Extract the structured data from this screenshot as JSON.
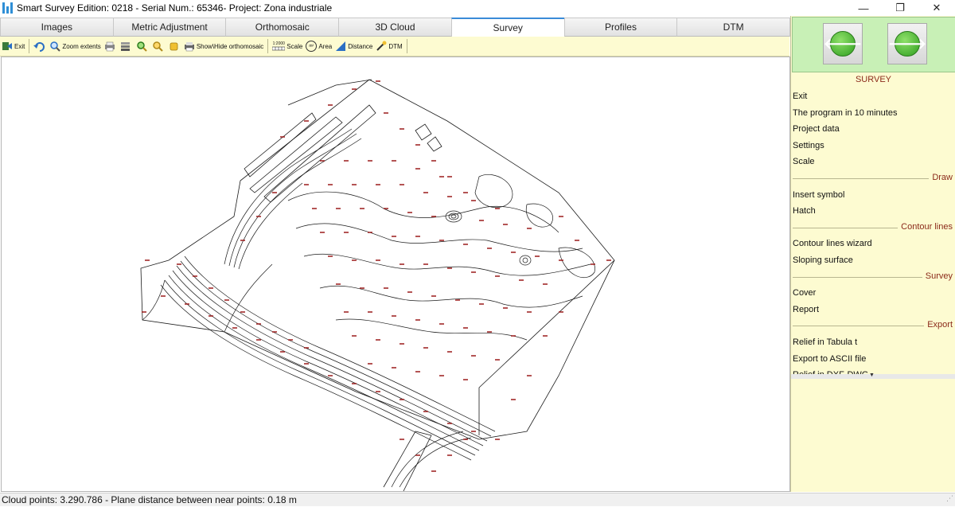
{
  "window": {
    "title": "Smart Survey  Edition: 0218 - Serial Num.: 65346- Project: Zona industriale",
    "minimize_glyph": "—",
    "restore_glyph": "❐",
    "close_glyph": "✕"
  },
  "tabs": [
    {
      "label": "Images"
    },
    {
      "label": "Metric Adjustment"
    },
    {
      "label": "Orthomosaic"
    },
    {
      "label": "3D Cloud"
    },
    {
      "label": "Survey",
      "active": true
    },
    {
      "label": "Profiles"
    },
    {
      "label": "DTM"
    }
  ],
  "toolbar": {
    "exit": "Exit",
    "zoom_extents": "Zoom extents",
    "show_hide_ortho": "Show\\Hide orthomosaic",
    "scale": "Scale",
    "area": "Area",
    "distance": "Distance",
    "dtm": "DTM",
    "scale_icon_text": "1:2000",
    "area_icon_text": "m²"
  },
  "sidebar": {
    "title": "SURVEY",
    "prev_glyph": "🡐",
    "next_glyph": "🡒",
    "items": [
      {
        "label": "Exit"
      },
      {
        "label": "The program in 10 minutes"
      },
      {
        "label": "Project data"
      },
      {
        "label": "Settings"
      },
      {
        "label": "Scale"
      }
    ],
    "sections": {
      "draw": "Draw",
      "contour": "Contour lines",
      "survey": "Survey",
      "export": "Export"
    },
    "draw_items": [
      {
        "label": "Insert symbol"
      },
      {
        "label": "Hatch"
      }
    ],
    "contour_items": [
      {
        "label": "Contour lines wizard"
      },
      {
        "label": "Sloping surface"
      }
    ],
    "survey_items": [
      {
        "label": "Cover"
      },
      {
        "label": "Report"
      }
    ],
    "export_items": [
      {
        "label": "Relief in Tabula t"
      },
      {
        "label": "Export to ASCII file"
      },
      {
        "label": "Relief in DXF-DWG"
      }
    ],
    "scroll_glyph": "▼"
  },
  "status": {
    "text": "Cloud points: 3.290.786 - Plane distance between near points: 0.18 m"
  },
  "colors": {
    "panel_bg": "#fdfbd1",
    "nav_bg": "#c8f0b6",
    "contour": "#1a1a1a",
    "elevation_labels": "#9b1c1c",
    "section_label": "#8b2a1a"
  }
}
